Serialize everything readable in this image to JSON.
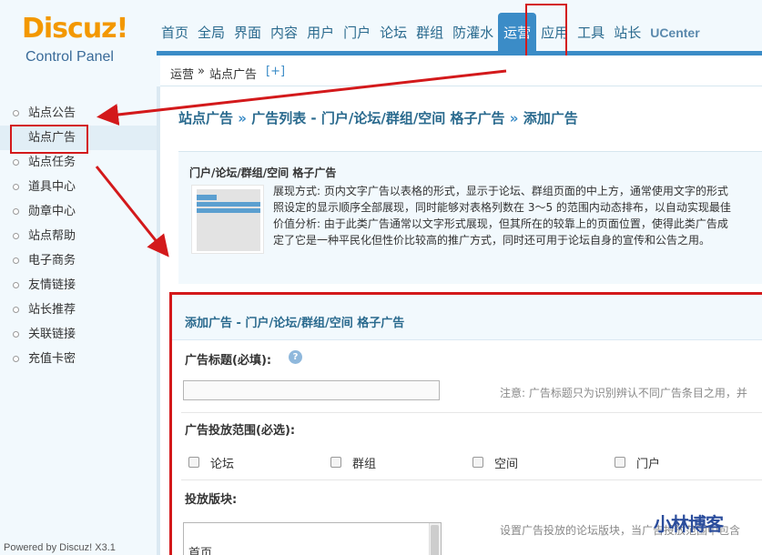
{
  "logo": {
    "main": "Discuz!",
    "sub": "Control Panel"
  },
  "topnav": [
    {
      "label": "首页"
    },
    {
      "label": "全局"
    },
    {
      "label": "界面"
    },
    {
      "label": "内容"
    },
    {
      "label": "用户"
    },
    {
      "label": "门户"
    },
    {
      "label": "论坛"
    },
    {
      "label": "群组"
    },
    {
      "label": "防灌水"
    },
    {
      "label": "运营",
      "active": true
    },
    {
      "label": "应用"
    },
    {
      "label": "工具"
    },
    {
      "label": "站长"
    },
    {
      "label": "UCenter"
    }
  ],
  "breadcrumb": {
    "section": "运营",
    "sep": "»",
    "page": "站点广告",
    "add": "[+]"
  },
  "sidebar": {
    "items": [
      {
        "label": "站点公告"
      },
      {
        "label": "站点广告",
        "active": true
      },
      {
        "label": "站点任务"
      },
      {
        "label": "道具中心"
      },
      {
        "label": "勋章中心"
      },
      {
        "label": "站点帮助"
      },
      {
        "label": "电子商务"
      },
      {
        "label": "友情链接"
      },
      {
        "label": "站长推荐"
      },
      {
        "label": "关联链接"
      },
      {
        "label": "充值卡密"
      }
    ],
    "footer": "Powered by Discuz! X3.1"
  },
  "main": {
    "title": {
      "part1": "站点广告",
      "sep": "»",
      "part2": "广告列表 - 门户/论坛/群组/空间 格子广告",
      "part3": "添加广告"
    },
    "desc": {
      "title": "门户/论坛/群组/空间 格子广告",
      "lines": [
        "展现方式: 页内文字广告以表格的形式，显示于论坛、群组页面的中上方，通常使用文字的形式",
        "照设定的显示顺序全部展现，同时能够对表格列数在 3～5 的范围内动态排布，以自动实现最佳",
        "价值分析: 由于此类广告通常以文字形式展现，但其所在的较靠上的页面位置，使得此类广告成",
        "定了它是一种平民化但性价比较高的推广方式，同时还可用于论坛自身的宣传和公告之用。"
      ]
    },
    "form": {
      "header": "添加广告 - 门户/论坛/群组/空间 格子广告",
      "title_label": "广告标题(必填):",
      "help_icon": "?",
      "title_value": "",
      "title_hint": "注意: 广告标题只为识别辨认不同广告条目之用，并",
      "scope_label": "广告投放范围(必选):",
      "scope_options": [
        "论坛",
        "群组",
        "空间",
        "门户"
      ],
      "forum_label": "投放版块:",
      "forum_hint": "设置广告投放的论坛版块，当广告投放范围中包含",
      "forum_options": [
        "首页"
      ]
    }
  },
  "watermark": "小林博客",
  "colors": {
    "accent": "#3b8cc7",
    "highlight": "#d3191b",
    "logo": "#f39800"
  }
}
